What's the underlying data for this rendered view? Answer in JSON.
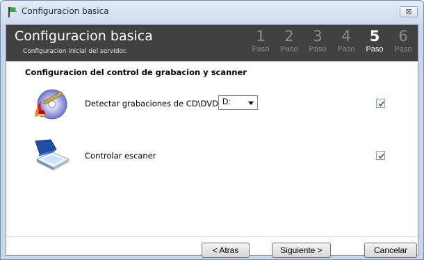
{
  "window": {
    "title": "Configuracion basica",
    "close_label": "⊠"
  },
  "header": {
    "title": "Configuracion basica",
    "subtitle": "Configuracion inicial del servidor.",
    "steps": [
      {
        "number": "1",
        "label": "Paso",
        "active": false
      },
      {
        "number": "2",
        "label": "Paso",
        "active": false
      },
      {
        "number": "3",
        "label": "Paso",
        "active": false
      },
      {
        "number": "4",
        "label": "Paso",
        "active": false
      },
      {
        "number": "5",
        "label": "Paso",
        "active": true
      },
      {
        "number": "6",
        "label": "Paso",
        "active": false
      }
    ]
  },
  "section": {
    "title": "Configuracion del control de grabacion y scanner"
  },
  "rows": {
    "cd": {
      "label": "Detectar grabaciones de CD\\DVD",
      "drive_selected": "D:",
      "checked": true,
      "icon": "cd-burner-icon"
    },
    "scanner": {
      "label": "Controlar escaner",
      "checked": true,
      "icon": "scanner-icon"
    }
  },
  "footer": {
    "back_label": "< Atras",
    "next_label": "Siguiente >",
    "cancel_label": "Cancelar"
  },
  "colors": {
    "header_bg": "#414141",
    "active_step": "#ffffff",
    "inactive_step": "#8f8f8f",
    "frame": "#c7d6e8"
  }
}
